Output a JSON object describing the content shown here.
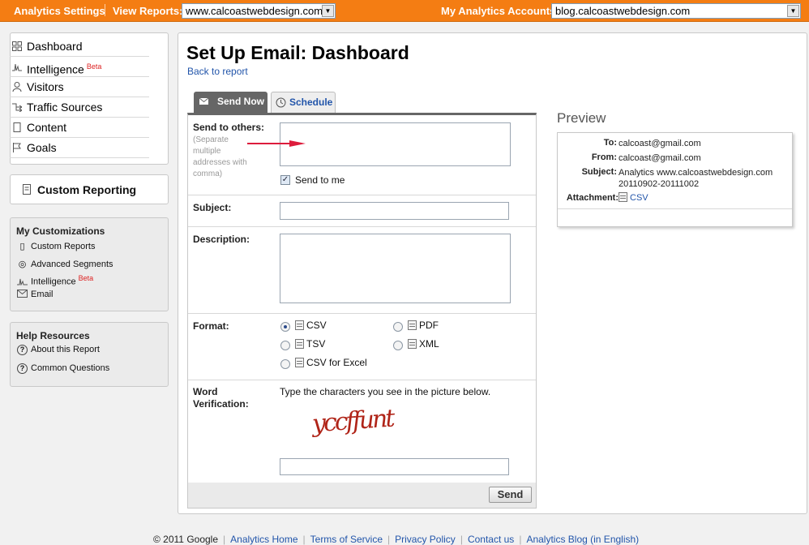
{
  "topbar": {
    "settings_link": "Analytics Settings",
    "view_reports_label": "View Reports:",
    "view_reports_value": "www.calcoastwebdesign.com",
    "accounts_label": "My Analytics Accounts:",
    "accounts_value": "blog.calcoastwebdesign.com",
    "color": "#f47d13"
  },
  "nav": {
    "items": [
      {
        "label": "Dashboard",
        "icon": "grid-icon"
      },
      {
        "label": "Intelligence",
        "icon": "pulse-icon",
        "badge": "Beta"
      },
      {
        "label": "Visitors",
        "icon": "person-icon"
      },
      {
        "label": "Traffic Sources",
        "icon": "branch-icon"
      },
      {
        "label": "Content",
        "icon": "page-icon"
      },
      {
        "label": "Goals",
        "icon": "flag-icon"
      }
    ],
    "custom_reporting": "Custom Reporting"
  },
  "customizations": {
    "title": "My Customizations",
    "items": [
      {
        "label": "Custom Reports",
        "icon": "report-icon"
      },
      {
        "label": "Advanced Segments",
        "icon": "segments-icon"
      },
      {
        "label": "Intelligence",
        "icon": "pulse-icon",
        "badge": "Beta"
      },
      {
        "label": "Email",
        "icon": "envelope-icon"
      }
    ]
  },
  "help": {
    "title": "Help Resources",
    "items": [
      {
        "label": "About this Report",
        "icon": "question-icon"
      },
      {
        "label": "Common Questions",
        "icon": "question-icon"
      }
    ]
  },
  "main": {
    "title": "Set Up Email: Dashboard",
    "back_link": "Back to report",
    "tabs": [
      {
        "label": "Send Now",
        "icon": "envelope-icon",
        "active": true
      },
      {
        "label": "Schedule",
        "icon": "clock-icon",
        "active": false
      }
    ],
    "form": {
      "send_to_label": "Send to others:",
      "send_to_hint": "(Separate multiple addresses with comma)",
      "send_to_value": "",
      "send_to_me_label": "Send to me",
      "send_to_me_checked": true,
      "subject_label": "Subject:",
      "subject_value": "",
      "description_label": "Description:",
      "description_value": "",
      "format_label": "Format:",
      "formats": [
        {
          "label": "CSV",
          "checked": true
        },
        {
          "label": "PDF",
          "checked": false
        },
        {
          "label": "TSV",
          "checked": false
        },
        {
          "label": "XML",
          "checked": false
        },
        {
          "label": "CSV for Excel",
          "checked": false
        }
      ],
      "verification_label_1": "Word",
      "verification_label_2": "Verification:",
      "verification_instructions": "Type the characters you see in the picture below.",
      "captcha_text": "yccffunt",
      "verification_value": "",
      "send_button": "Send"
    }
  },
  "preview": {
    "title": "Preview",
    "to_label": "To:",
    "to_value": "calcoast@gmail.com",
    "from_label": "From:",
    "from_value": "calcoast@gmail.com",
    "subject_label": "Subject:",
    "subject_value": "Analytics www.calcoastwebdesign.com 20110902-20111002",
    "attachment_label": "Attachment:",
    "attachment_value": "CSV"
  },
  "footer": {
    "copyright": "© 2011 Google",
    "links": [
      "Analytics Home",
      "Terms of Service",
      "Privacy Policy",
      "Contact us",
      "Analytics Blog (in English)"
    ]
  }
}
